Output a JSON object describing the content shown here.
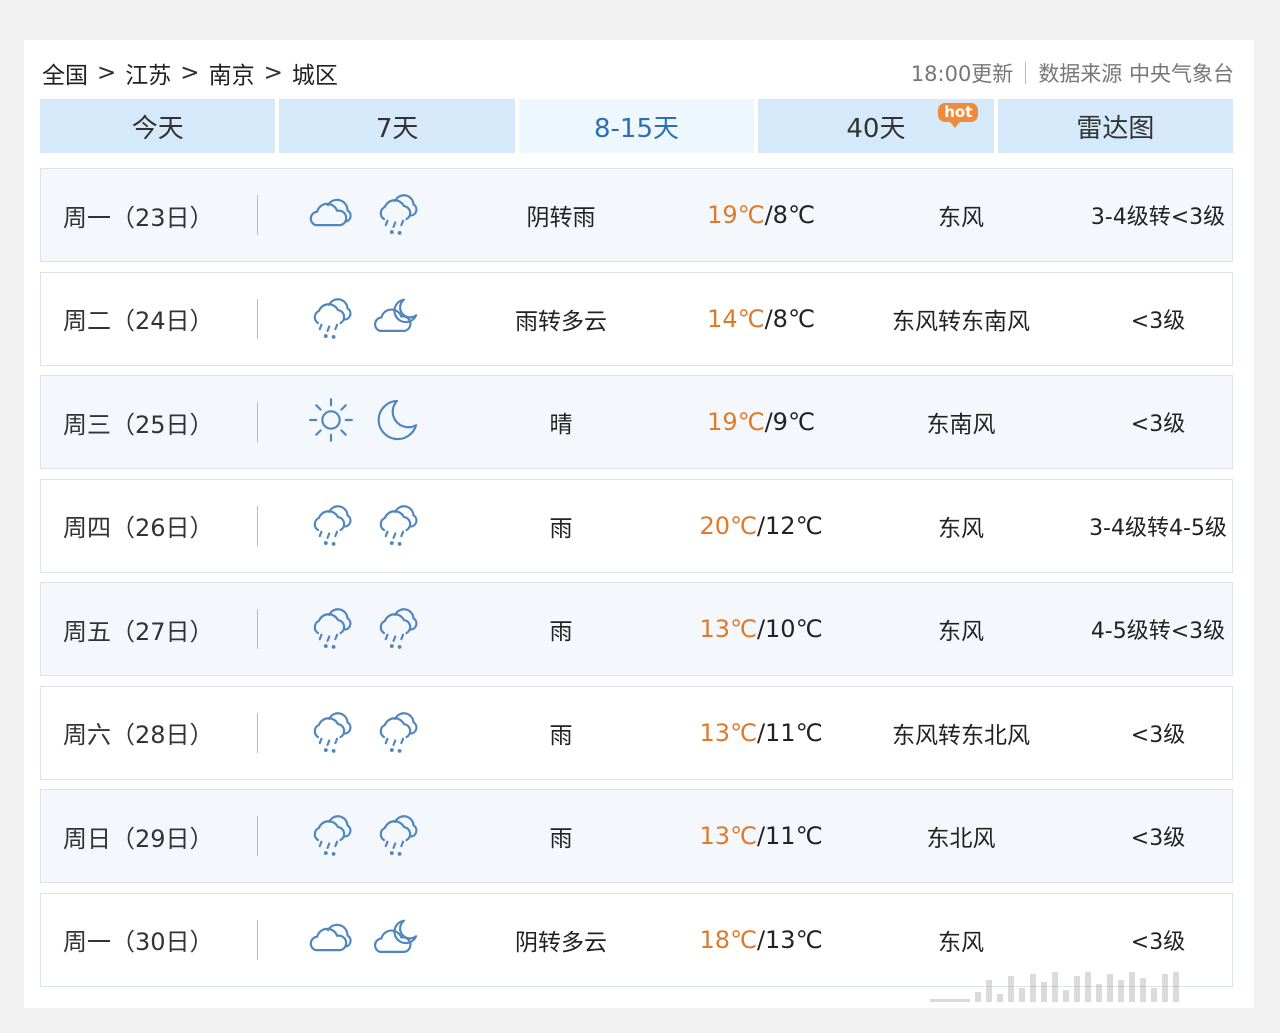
{
  "breadcrumb": [
    "全国",
    "江苏",
    "南京",
    "城区"
  ],
  "breadcrumb_sep": ">",
  "meta": {
    "updated": "18:00更新",
    "source": "数据来源 中央气象台"
  },
  "tabs": [
    {
      "label": "今天",
      "active": false
    },
    {
      "label": "7天",
      "active": false
    },
    {
      "label": "8-15天",
      "active": true
    },
    {
      "label": "40天",
      "active": false,
      "badge": "hot"
    },
    {
      "label": "雷达图",
      "active": false
    }
  ],
  "forecast": [
    {
      "day": "周一（23日）",
      "icon_day": "cloudy-icon",
      "icon_night": "rain-icon",
      "desc": "阴转雨",
      "high": "19℃",
      "low": "/8℃",
      "wind": "东风",
      "level": "3-4级转<3级"
    },
    {
      "day": "周二（24日）",
      "icon_day": "rain-icon",
      "icon_night": "cloudy-night-icon",
      "desc": "雨转多云",
      "high": "14℃",
      "low": "/8℃",
      "wind": "东风转东南风",
      "level": "<3级"
    },
    {
      "day": "周三（25日）",
      "icon_day": "sun-icon",
      "icon_night": "moon-icon",
      "desc": "晴",
      "high": "19℃",
      "low": "/9℃",
      "wind": "东南风",
      "level": "<3级"
    },
    {
      "day": "周四（26日）",
      "icon_day": "rain-icon",
      "icon_night": "rain-icon",
      "desc": "雨",
      "high": "20℃",
      "low": "/12℃",
      "wind": "东风",
      "level": "3-4级转4-5级"
    },
    {
      "day": "周五（27日）",
      "icon_day": "rain-icon",
      "icon_night": "rain-icon",
      "desc": "雨",
      "high": "13℃",
      "low": "/10℃",
      "wind": "东风",
      "level": "4-5级转<3级"
    },
    {
      "day": "周六（28日）",
      "icon_day": "rain-icon",
      "icon_night": "rain-icon",
      "desc": "雨",
      "high": "13℃",
      "low": "/11℃",
      "wind": "东风转东北风",
      "level": "<3级"
    },
    {
      "day": "周日（29日）",
      "icon_day": "rain-icon",
      "icon_night": "rain-icon",
      "desc": "雨",
      "high": "13℃",
      "low": "/11℃",
      "wind": "东北风",
      "level": "<3级"
    },
    {
      "day": "周一（30日）",
      "icon_day": "cloudy-icon",
      "icon_night": "cloudy-night-icon",
      "desc": "阴转多云",
      "high": "18℃",
      "low": "/13℃",
      "wind": "东风",
      "level": "<3级"
    }
  ],
  "colors": {
    "accent": "#2d6fb3",
    "tab_bg": "#d6e9fb",
    "high_temp": "#e07a2b",
    "icon": "#4f86bd"
  }
}
